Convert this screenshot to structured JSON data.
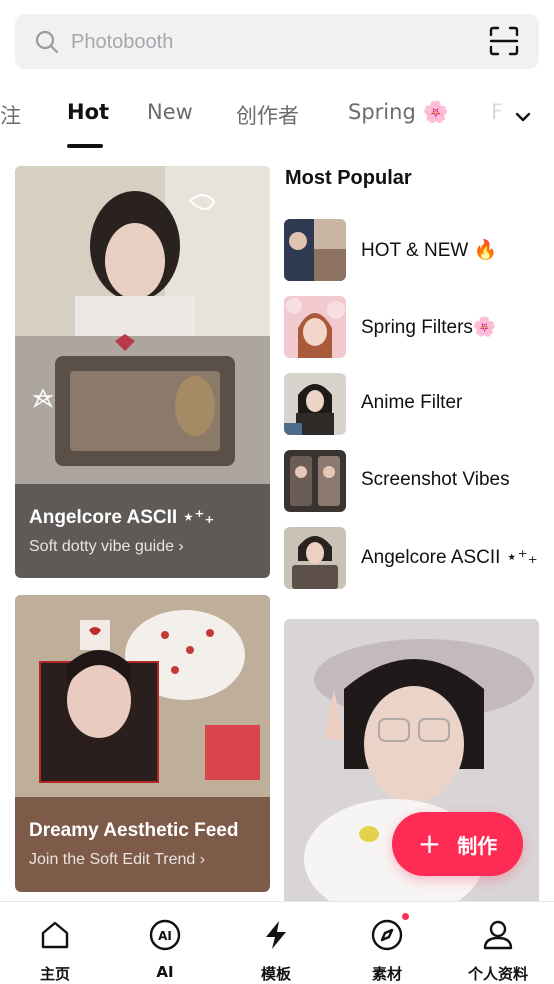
{
  "search": {
    "placeholder": "Photobooth",
    "icon": "search-icon",
    "scan_icon": "scan-icon"
  },
  "tabs": [
    {
      "label": "注",
      "active": false
    },
    {
      "label": "Hot",
      "active": true
    },
    {
      "label": "New",
      "active": false
    },
    {
      "label": "创作者",
      "active": false
    },
    {
      "label": "Spring 🌸",
      "active": false
    },
    {
      "label": "F",
      "active": false
    }
  ],
  "feed": {
    "card1": {
      "title": "Angelcore ASCII ⋆⁺₊",
      "subtitle": "Soft dotty vibe guide ›"
    },
    "card2": {
      "title": "Dreamy Aesthetic Feed",
      "subtitle": "Join the Soft Edit Trend ›"
    }
  },
  "most_popular": {
    "title": "Most Popular",
    "items": [
      {
        "label": "HOT & NEW 🔥"
      },
      {
        "label": "Spring Filters🌸"
      },
      {
        "label": "Anime Filter"
      },
      {
        "label": "Screenshot Vibes"
      },
      {
        "label": "Angelcore ASCII ⋆⁺₊"
      }
    ]
  },
  "fab": {
    "plus": "+",
    "label": "制作"
  },
  "bottom_nav": [
    {
      "label": "主页",
      "icon": "home-icon"
    },
    {
      "label": "AI",
      "icon": "ai-icon"
    },
    {
      "label": "模板",
      "icon": "bolt-icon"
    },
    {
      "label": "素材",
      "icon": "compass-icon",
      "badge": true
    },
    {
      "label": "个人资料",
      "icon": "profile-icon"
    }
  ],
  "colors": {
    "accent": "#fe2c55",
    "text": "#111111",
    "muted": "#6c6c6c",
    "search_bg": "#f1f1f3"
  }
}
